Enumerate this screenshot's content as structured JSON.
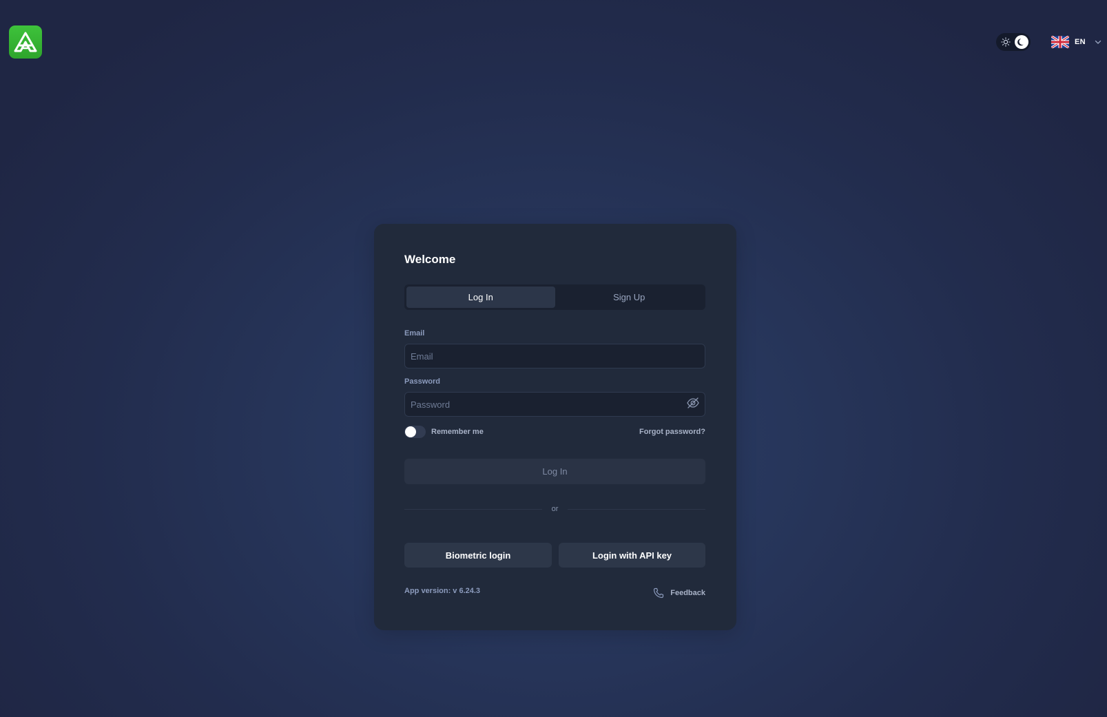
{
  "header": {
    "logo_icon": "app-logo-icon",
    "theme_toggle": {
      "state": "dark",
      "icons": [
        "sun-icon",
        "moon-icon"
      ]
    },
    "language": {
      "code": "EN",
      "flag_icon": "uk-flag-icon"
    }
  },
  "card": {
    "title": "Welcome",
    "tabs": [
      {
        "label": "Log In",
        "active": true
      },
      {
        "label": "Sign Up",
        "active": false
      }
    ],
    "email": {
      "label": "Email",
      "placeholder": "Email",
      "value": ""
    },
    "password": {
      "label": "Password",
      "placeholder": "Password",
      "value": ""
    },
    "remember_me": {
      "label": "Remember me",
      "checked": false
    },
    "forgot_password": "Forgot password?",
    "login_button": "Log In",
    "divider_text": "or",
    "biometric_button": "Biometric login",
    "api_key_button": "Login with API key",
    "app_version": "App version: v 6.24.3",
    "feedback": "Feedback"
  },
  "colors": {
    "brand_green": "#35b532",
    "card_bg": "#212a3b",
    "background": "#27365b"
  }
}
